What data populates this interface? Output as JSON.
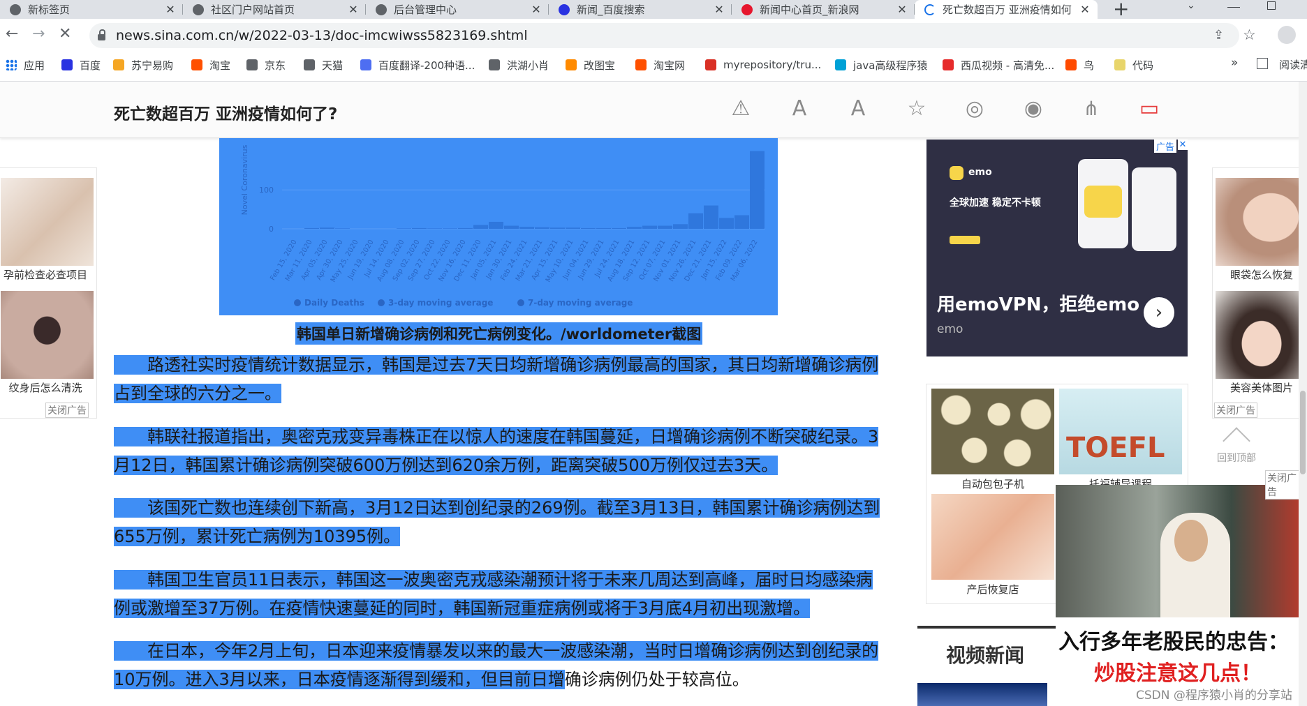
{
  "tabs": [
    {
      "title": "新标签页",
      "icon": "chrome-icon",
      "color": "#5f6368"
    },
    {
      "title": "社区门户网站首页",
      "icon": "globe-icon",
      "color": "#5f6368"
    },
    {
      "title": "后台管理中心",
      "icon": "globe-icon",
      "color": "#5f6368"
    },
    {
      "title": "新闻_百度搜索",
      "icon": "baidu-paw-icon",
      "color": "#2932e1"
    },
    {
      "title": "新闻中心首页_新浪网",
      "icon": "weibo-eye-icon",
      "color": "#e6162d"
    },
    {
      "title": "死亡数超百万 亚洲疫情如何",
      "icon": "loading-spinner-icon",
      "color": "#1a73e8"
    }
  ],
  "tab_close_glyph": "✕",
  "new_tab_glyph": "+",
  "address": {
    "url": "news.sina.com.cn/w/2022-03-13/doc-imcwiwss5823169.shtml"
  },
  "bookmarks": [
    {
      "label": "应用",
      "color": "#1a73e8"
    },
    {
      "label": "百度",
      "color": "#2932e1"
    },
    {
      "label": "苏宁易购",
      "color": "#f5a623"
    },
    {
      "label": "淘宝",
      "color": "#ff5000"
    },
    {
      "label": "京东",
      "color": "#5f6368"
    },
    {
      "label": "天猫",
      "color": "#5f6368"
    },
    {
      "label": "百度翻译-200种语...",
      "color": "#4e6ef2"
    },
    {
      "label": "洪湖小肖",
      "color": "#5f6368"
    },
    {
      "label": "改图宝",
      "color": "#ff8a00"
    },
    {
      "label": "淘宝网",
      "color": "#ff5000"
    },
    {
      "label": "myrepository/tru...",
      "color": "#d93025"
    },
    {
      "label": "java高级程序猿",
      "color": "#00a1d6"
    },
    {
      "label": "西瓜视频 - 高清免...",
      "color": "#e62b2b"
    },
    {
      "label": "鸟",
      "color": "#ff4a00"
    },
    {
      "label": "代码",
      "color": "#e8d56b"
    }
  ],
  "bookmarks_more": "»",
  "reading_list": "阅读清",
  "article": {
    "title": "死亡数超百万 亚洲疫情如何了?",
    "caption": "韩国单日新增确诊病例和死亡病例变化。/worldometer截图",
    "paragraphs": [
      {
        "sel": "　　路透社实时疫情统计数据显示，韩国是过去7天日均新增确诊病例最高的国家，其日均新增确诊病例占到全球的六分之一。",
        "rest": ""
      },
      {
        "sel": "　　韩联社报道指出，奥密克戎变异毒株正在以惊人的速度在韩国蔓延，日增确诊病例不断突破纪录。3月12日，韩国累计确诊病例突破600万例达到620余万例，距离突破500万例仅过去3天。",
        "rest": ""
      },
      {
        "sel": "　　该国死亡数也连续创下新高，3月12日达到创纪录的269例。截至3月13日，韩国累计确诊病例达到655万例，累计死亡病例为10395例。",
        "rest": ""
      },
      {
        "sel": "　　韩国卫生官员11日表示，韩国这一波奥密克戎感染潮预计将于未来几周达到高峰，届时日均感染病例或激增至37万例。在疫情快速蔓延的同时，韩国新冠重症病例或将于3月底4月初出现激增。",
        "rest": ""
      },
      {
        "sel": "　　在日本，今年2月上旬，日本迎来疫情暴发以来的最大一波感染潮，当时日增确诊病例达到创纪录的10万例。进入3月以来，日本疫情逐渐得到缓和，但目前日增",
        "rest": "确诊病例仍处于较高位。"
      }
    ]
  },
  "chart_data": {
    "type": "bar",
    "ylabel": "Novel Coronavirus",
    "yticks": [
      "0",
      "100"
    ],
    "ylim": [
      0,
      269
    ],
    "categories": [
      "Feb 15, 2020",
      "Mar 11, 2020",
      "Apr 05, 2020",
      "Apr 30, 2020",
      "May 25, 2020",
      "Jun 19, 2020",
      "Jul 14, 2020",
      "Aug 08, 2020",
      "Sep 02, 2020",
      "Sep 27, 2020",
      "Oct 22, 2020",
      "Nov 16, 2020",
      "Dec 11, 2020",
      "Jan 05, 2021",
      "Jan 30, 2021",
      "Feb 24, 2021",
      "Mar 21, 2021",
      "Apr 15, 2021",
      "May 10, 2021",
      "Jun 04, 2021",
      "Jun 29, 2021",
      "Jul 24, 2021",
      "Aug 18, 2021",
      "Sep 12, 2021",
      "Oct 07, 2021",
      "Nov 01, 2021",
      "Nov 26, 2021",
      "Dec 21, 2021",
      "Jan 15, 2022",
      "Feb 09, 2022",
      "Mar 06, 2022"
    ],
    "values": [
      0,
      2,
      3,
      1,
      0,
      0,
      0,
      1,
      2,
      1,
      1,
      2,
      10,
      18,
      8,
      5,
      4,
      3,
      3,
      2,
      2,
      2,
      5,
      8,
      8,
      12,
      40,
      60,
      28,
      35,
      200
    ],
    "legend": [
      "Daily Deaths",
      "3-day moving average",
      "7-day moving average"
    ]
  },
  "toolbar_icons": [
    {
      "name": "report-icon"
    },
    {
      "name": "font-decrease-icon"
    },
    {
      "name": "font-increase-icon"
    },
    {
      "name": "favorite-star-icon"
    },
    {
      "name": "weibo-share-icon"
    },
    {
      "name": "wechat-share-icon"
    },
    {
      "name": "share-icon"
    },
    {
      "name": "comment-icon"
    }
  ],
  "ads": {
    "left_items": [
      "孕前检查必查项目",
      "纹身后怎么清洗"
    ],
    "left_close": "关闭广告",
    "right_items": [
      "眼袋怎么恢复",
      "美容美体图片"
    ],
    "right_close": "关闭广告",
    "back_to_top": "回到顶部",
    "ad_tag": "广告",
    "emo": {
      "brand": "emo",
      "slogan": "全球加速  稳定不卡顿",
      "headline": "用emoVPN，拒绝emo",
      "sub": "emo"
    },
    "grid": [
      {
        "label": "自动包包子机"
      },
      {
        "label": "托福辅导课程"
      },
      {
        "label": "产后恢复店"
      }
    ],
    "stock": {
      "line1": "入行多年老股民的忠告：",
      "line2": "炒股注意这几点！",
      "close": "关闭广告"
    },
    "video_news": "视频新闻",
    "watermark": "CSDN @程序猿小肖的分享站"
  }
}
